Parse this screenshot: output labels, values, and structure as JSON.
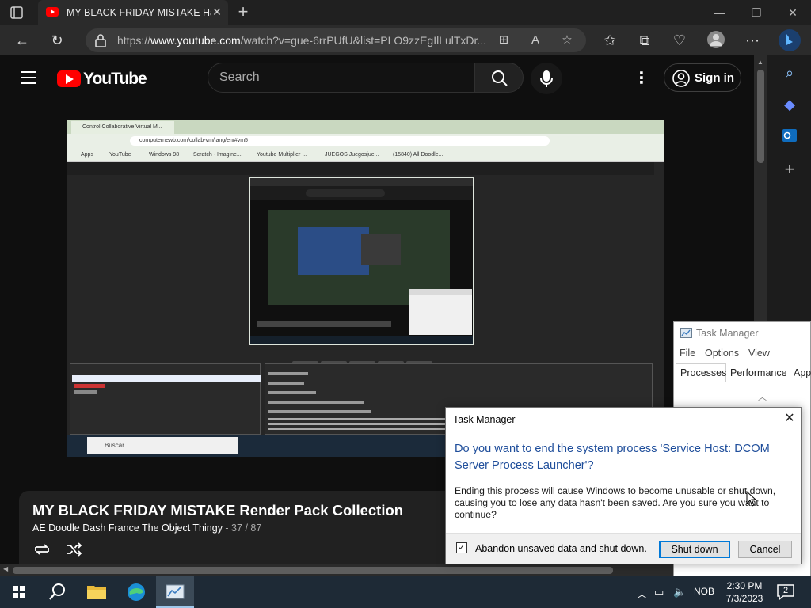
{
  "browser": {
    "tab_title": "MY BLACK FRIDAY MISTAKE Has",
    "tab_close": "✕",
    "new_tab": "+",
    "url_prefix": "https://",
    "url_host": "www.youtube.com",
    "url_path": "/watch?v=gue-6rrPUfU&list=PLO9zzEgIlLulTxDr...",
    "window_controls": [
      "minimize",
      "restore",
      "close"
    ]
  },
  "youtube": {
    "logo_text": "YouTube",
    "search_placeholder": "Search",
    "sign_in": "Sign in",
    "playlist": {
      "title": "MY BLACK FRIDAY MISTAKE Render Pack Collection",
      "channel": "AE Doodle Dash France The Object Thingy",
      "position": " - 37 / 87"
    }
  },
  "video_frame": {
    "inner_tab": "Control Collaborative Virtual M...",
    "inner_url": "computernewb.com/collab-vm/lang/en/#vm5",
    "bookmarks": [
      "Apps",
      "YouTube",
      "Windows 98",
      "Scratch - Imagine...",
      "Youtube Multiplier ...",
      "JUEGOS Juegosjue...",
      "(15840) All Doodle..."
    ],
    "taskbar_search": "Buscar"
  },
  "task_manager": {
    "title": "Task Manager",
    "menu": [
      "File",
      "Options",
      "View"
    ],
    "tabs": [
      "Processes",
      "Performance",
      "App"
    ]
  },
  "dialog": {
    "title": "Task Manager",
    "heading": "Do you want to end the system process 'Service Host: DCOM Server Process Launcher'?",
    "body": "Ending this process will cause Windows to become unusable or shut down, causing you to lose any data hasn't been saved. Are you sure you want to continue?",
    "checkbox_label": "Abandon unsaved data and shut down.",
    "checkbox_checked": true,
    "primary_button": "Shut down",
    "secondary_button": "Cancel"
  },
  "taskbar": {
    "language": "NOB",
    "time": "2:30 PM",
    "date": "7/3/2023",
    "notifications": "2"
  },
  "colors": {
    "youtube_red": "#ff0000",
    "dialog_heading": "#1f4e9b",
    "focus_border": "#0078d7"
  }
}
